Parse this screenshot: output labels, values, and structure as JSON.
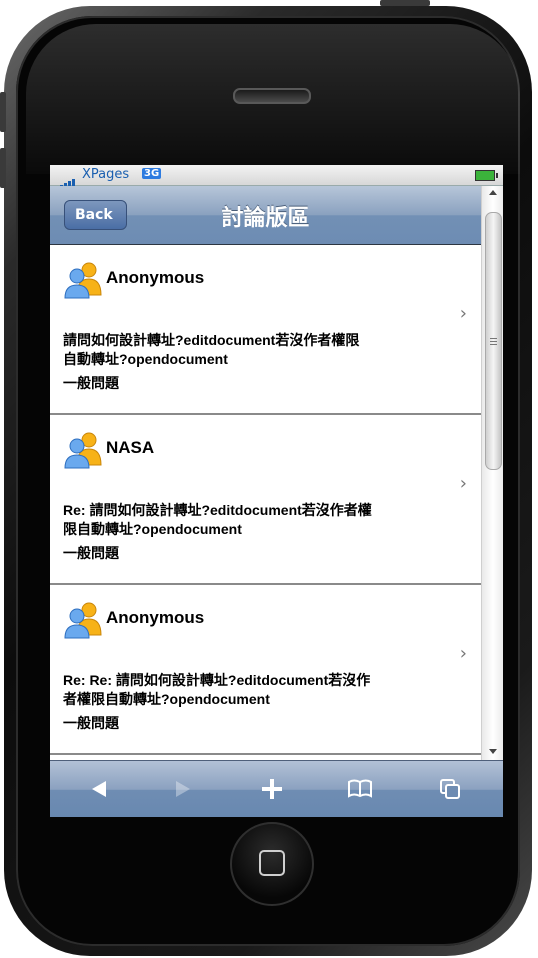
{
  "status_bar": {
    "carrier": "XPages",
    "network": "3G"
  },
  "nav": {
    "back_label": "Back",
    "title": "討論版區"
  },
  "posts": [
    {
      "author": "Anonymous",
      "subject_line1": "請問如何設計轉址?editdocument若沒作者權限",
      "subject_line2": "自動轉址?opendocument",
      "category": "一般問題"
    },
    {
      "author": "NASA",
      "subject_line1": "Re: 請問如何設計轉址?editdocument若沒作者權",
      "subject_line2": "限自動轉址?opendocument",
      "category": "一般問題"
    },
    {
      "author": "Anonymous",
      "subject_line1": "Re: Re: 請問如何設計轉址?editdocument若沒作",
      "subject_line2": "者權限自動轉址?opendocument",
      "category": "一般問題"
    }
  ],
  "icons": {
    "back": "back-arrow-icon",
    "forward": "forward-arrow-icon",
    "add": "plus-icon",
    "bookmarks": "book-icon",
    "pages": "pages-icon",
    "avatar": "user-group-icon",
    "chevron": "chevron-right-icon"
  },
  "colors": {
    "nav_bar": "#7290b5",
    "accent_blue": "#1a5fb0"
  }
}
